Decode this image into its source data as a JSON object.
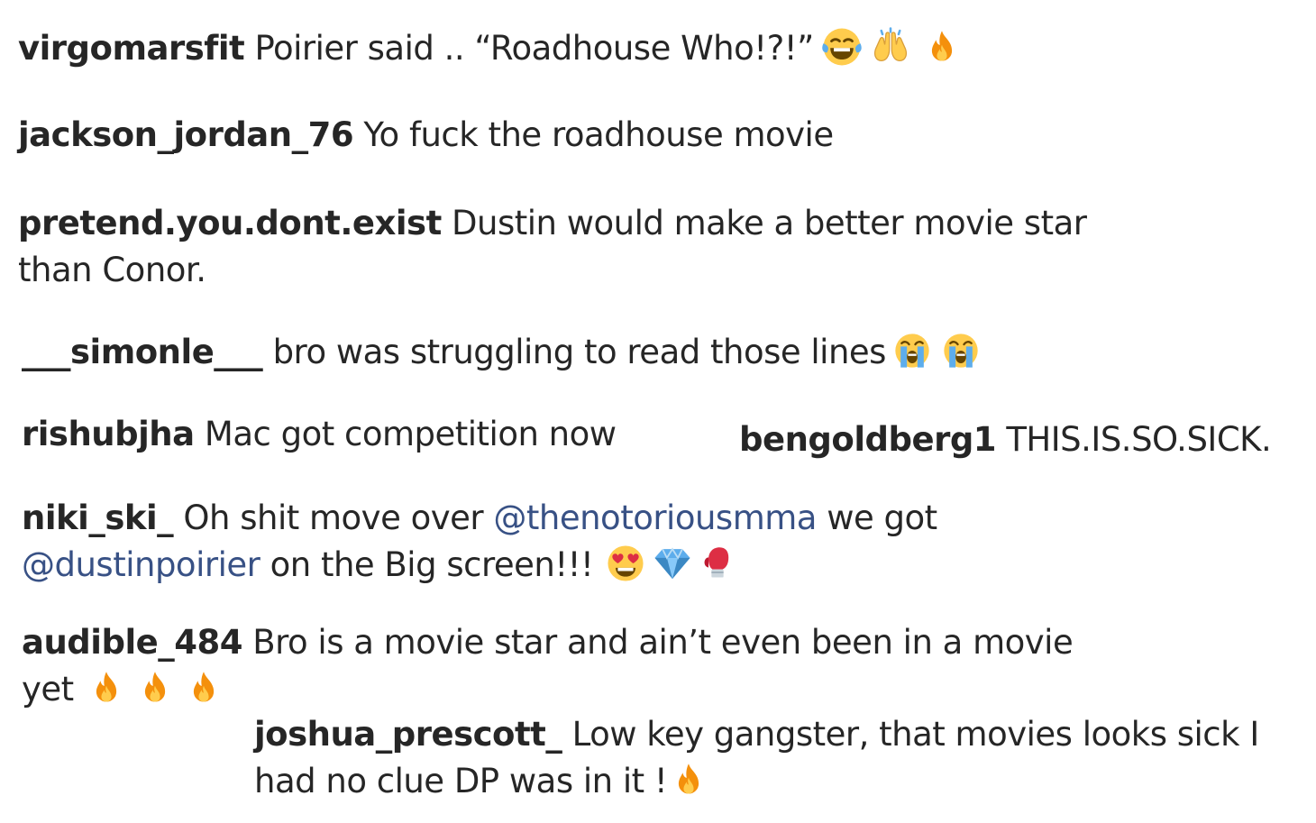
{
  "comments": [
    {
      "user": "virgomarsfit",
      "text": "Poirier said .. “Roadhouse Who!?!”"
    },
    {
      "user": "jackson_jordan_76",
      "text": "Yo fuck the roadhouse movie"
    },
    {
      "user": "pretend.you.dont.exist",
      "text": "Dustin would make a better movie star",
      "text2": "than Conor."
    },
    {
      "user": "___simonle___",
      "text": "bro was struggling to read those lines"
    },
    {
      "user": "rishubjha",
      "text": "Mac got competition now"
    },
    {
      "user": "bengoldberg1",
      "text": "THIS.IS.SO.SICK."
    },
    {
      "user": "niki_ski_",
      "text_a": "Oh shit move over",
      "mention1": "@thenotoriousmma",
      "text_b": "we got",
      "mention2": "@dustinpoirier",
      "text_c": "on the Big screen!!!"
    },
    {
      "user": "audible_484",
      "text": "Bro is a movie star and ain’t even been in a movie",
      "text2": "yet"
    },
    {
      "user": "joshua_prescott_",
      "text": "Low key gangster, that movies looks sick I",
      "text2": "had no clue DP was in it !"
    }
  ],
  "emoji": {
    "c0": [
      "joy-icon",
      "raising-hands-icon",
      "fire-icon"
    ],
    "c3": [
      "loudly-crying-icon",
      "loudly-crying-icon"
    ],
    "c6": [
      "heart-eyes-icon",
      "gem-icon",
      "boxing-glove-icon"
    ],
    "c7": [
      "fire-icon",
      "fire-icon",
      "fire-icon"
    ],
    "c8": [
      "fire-icon"
    ]
  },
  "colors": {
    "text": "#262626",
    "mention": "#385185",
    "fire": "#f4900c"
  }
}
